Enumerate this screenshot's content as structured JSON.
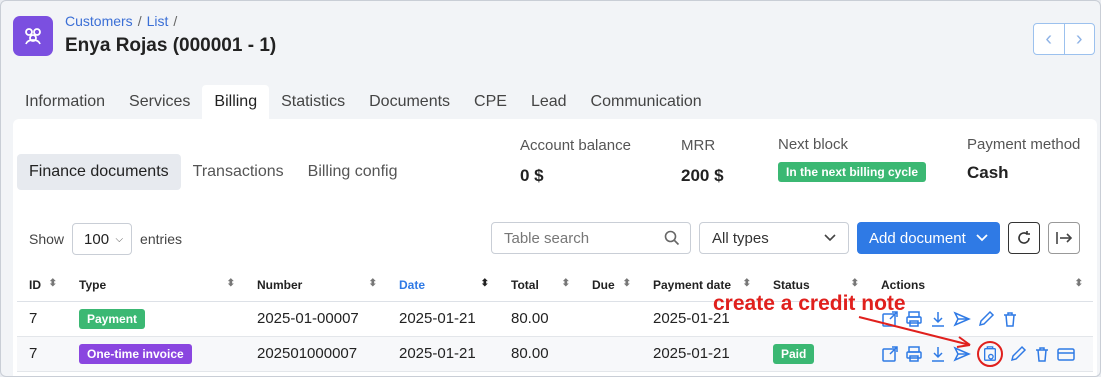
{
  "breadcrumb": {
    "items": [
      "Customers",
      "List"
    ]
  },
  "page_title": "Enya Rojas (000001 - 1)",
  "tabs": [
    "Information",
    "Services",
    "Billing",
    "Statistics",
    "Documents",
    "CPE",
    "Lead",
    "Communication"
  ],
  "active_tab": "Billing",
  "subtabs": [
    "Finance documents",
    "Transactions",
    "Billing config"
  ],
  "stats": {
    "account_balance": {
      "label": "Account balance",
      "value": "0 $"
    },
    "mrr": {
      "label": "MRR",
      "value": "200 $"
    },
    "next_block": {
      "label": "Next block",
      "value": "In the next billing cycle"
    },
    "payment_method": {
      "label": "Payment method",
      "value": "Cash"
    }
  },
  "controls": {
    "show_label": "Show",
    "entries_value": "100",
    "entries_label": "entries",
    "search_placeholder": "Table search",
    "type_filter": "All types",
    "add_document": "Add document"
  },
  "table": {
    "headers": [
      "ID",
      "Type",
      "Number",
      "Date",
      "Total",
      "Due",
      "Payment date",
      "Status",
      "Actions"
    ],
    "rows": [
      {
        "id": "7",
        "type": "Payment",
        "type_color": "#3bb873",
        "number": "2025-01-00007",
        "date": "2025-01-21",
        "total": "80.00",
        "due": "",
        "payment_date": "2025-01-21",
        "status": ""
      },
      {
        "id": "7",
        "type": "One-time invoice",
        "type_color": "#8a46e0",
        "number": "202501000007",
        "date": "2025-01-21",
        "total": "80.00",
        "due": "",
        "payment_date": "2025-01-21",
        "status": "Paid"
      }
    ]
  },
  "annotation": {
    "text": "create a credit note",
    "color": "#e0201d"
  },
  "colors": {
    "accent": "#2f7ae5",
    "brand": "#7b4fe0",
    "success": "#3bb873"
  }
}
